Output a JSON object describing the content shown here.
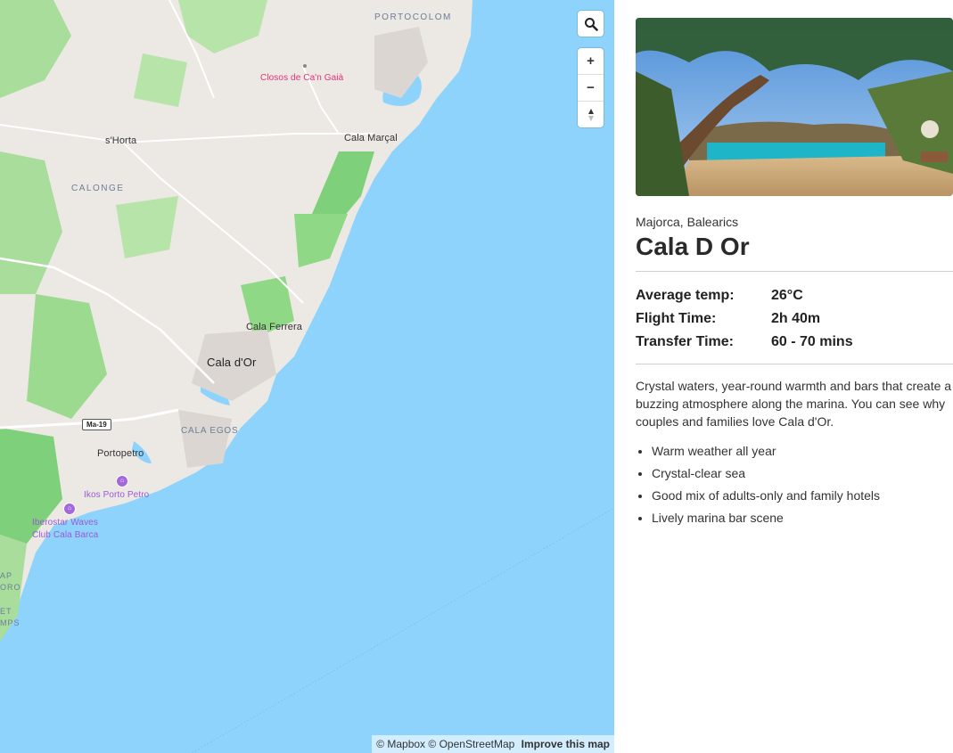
{
  "map": {
    "labels": {
      "portocolom": "PORTOCOLOM",
      "closos": "Closos de Ca'n Gaià",
      "shorta": "s'Horta",
      "cala_marcal": "Cala Marçal",
      "calonge": "CALONGE",
      "cala_ferrera": "Cala Ferrera",
      "cala_dor": "Cala d'Or",
      "road": "Ma-19",
      "cala_egos": "CALA EGOS",
      "portopetro": "Portopetro",
      "ikos": "Ikos Porto Petro",
      "iberostar_1": "Iberostar Waves",
      "iberostar_2": "Club Cala Barca",
      "cut_1": "AP",
      "cut_2": "ORO",
      "cut_3": "ET",
      "cut_4": "MPS"
    },
    "controls": {
      "search_icon": "magnifier",
      "zoom_in": "+",
      "zoom_out": "−",
      "compass": "▲"
    },
    "attribution": {
      "mapbox": "© Mapbox",
      "osm": "© OpenStreetMap",
      "improve": "Improve this map"
    },
    "colors": {
      "sea": "#8dd3fc",
      "land": "#ece8e4",
      "park": "#b7e4a8",
      "forest": "#7fd07a"
    }
  },
  "destination": {
    "region": "Majorca, Balearics",
    "name": "Cala D Or",
    "stats": [
      {
        "label": "Average temp:",
        "value": "26°C"
      },
      {
        "label": "Flight Time:",
        "value": "2h 40m"
      },
      {
        "label": "Transfer Time:",
        "value": "60 - 70 mins"
      }
    ],
    "description": "Crystal waters, year-round warmth and bars that create a buzzing atmosphere along the marina. You can see why couples and families love Cala d'Or.",
    "features": [
      "Warm weather all year",
      "Crystal-clear sea",
      "Good mix of adults-only and family hotels",
      "Lively marina bar scene"
    ]
  }
}
